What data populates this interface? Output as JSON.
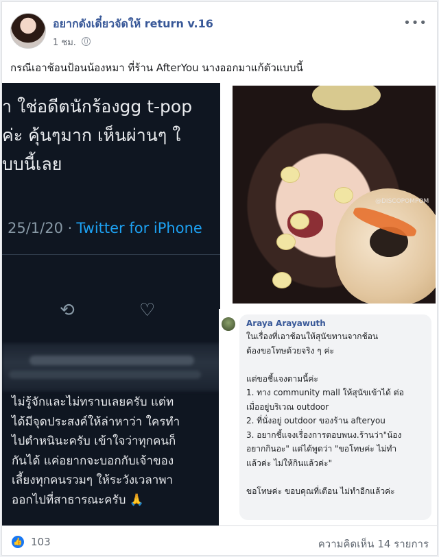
{
  "post": {
    "author": "อยากดังเดี๋ยวจัดให้ return v.16",
    "time": "1 ชม.",
    "caption": "กรณีเอาช้อนป้อนน้องหมา ที่ร้าน AfterYou นางออกมาแก้ตัวแบบนี้",
    "more_icon": "more-icon",
    "privacy_icon": "globe-icon"
  },
  "tweet": {
    "lines": [
      "า ใช่อดีตนักร้องgg t-pop",
      "ค่ะ คุ้นๆมาก เห็นผ่านๆ ใ",
      "บบนี้เลย"
    ],
    "date": "25/1/20 ·",
    "source": "Twitter for iPhone",
    "reply_lines": [
      "ไม่รู้จักและไม่ทราบเลยครับ แต่ท",
      "ได้มีจุดประสงค์ให้ล่าหาว่า ใครทำ",
      "ไปตำหนินะครับ เข้าใจว่าทุกคนก็",
      "กันได้ แค่อยากจะบอกกับเจ้าของ",
      "เลี้ยงทุกคนรวมๆ ให้ระวังเวลาพา",
      "ออกไปที่สาธารณะครับ 🙏"
    ]
  },
  "photo": {
    "watermark": "@DISCOPOMPOM"
  },
  "comment": {
    "name": "Araya Arayawuth",
    "lines": [
      "ในเรื่องที่เอาช้อนให้สุนัขทานจากช้อน",
      "ต้องขอโทษด้วยจริง ๆ ค่ะ",
      "",
      "แต่ขอชี้แจงตามนี้ค่ะ",
      "1. ทาง community mall ให้สุนัขเข้าได้ ต่อ",
      "เมื่ออยู่บริเวณ outdoor",
      "2. ที่นั่งอยู่ outdoor ของร้าน afteryou",
      "3. อยากชี้แจงเรื่องการตอบพนง.ร้านว่า\"น้อง",
      "อยากกินอะ\" แต่ได้พูดว่า \"ขอโทษค่ะ ไม่ทำ",
      "แล้วค่ะ ไม่ให้กินแล้วค่ะ\"",
      "",
      "ขอโทษค่ะ ขอบคุณที่เตือน ไม่ทำอีกแล้วค่ะ"
    ]
  },
  "footer": {
    "likes": "103",
    "comments": "ความคิดเห็น 14 รายการ"
  }
}
